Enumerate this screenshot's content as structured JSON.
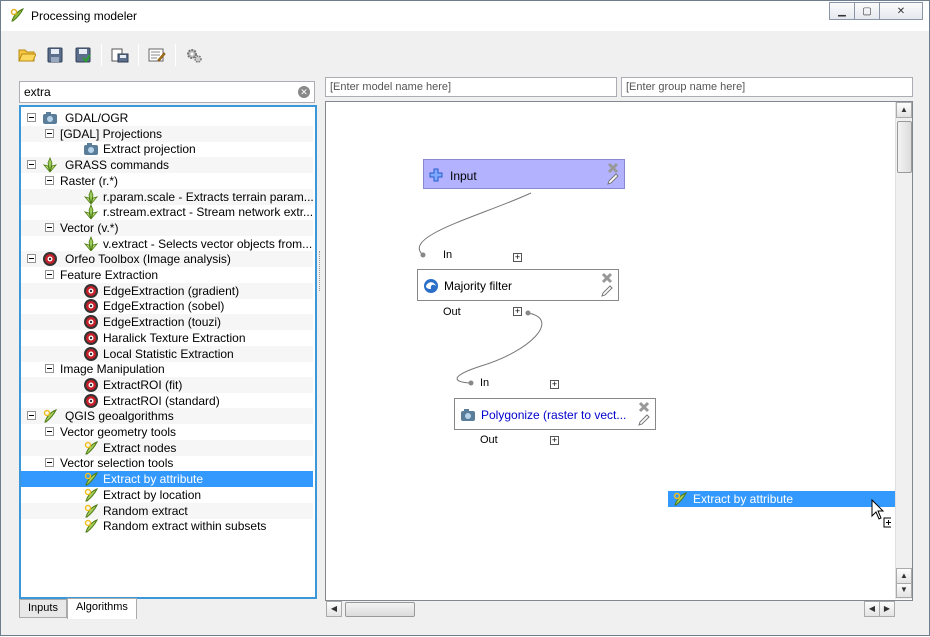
{
  "window": {
    "title": "Processing modeler",
    "minimize": "▁",
    "maximize": "▢",
    "close": "✕"
  },
  "toolbar": {
    "buttons": [
      {
        "name": "open-model",
        "icon": "folder-open-icon"
      },
      {
        "name": "save-model",
        "icon": "save-icon"
      },
      {
        "name": "save-as-model",
        "icon": "save-as-icon"
      },
      {
        "name": "export-image",
        "icon": "export-image-icon"
      },
      {
        "name": "edit-help",
        "icon": "edit-help-icon"
      },
      {
        "name": "run-model",
        "icon": "run-gears-icon"
      }
    ]
  },
  "search": {
    "value": "extra",
    "clear_icon": "✕"
  },
  "tree": {
    "rows": [
      {
        "label": "GDAL/OGR",
        "level": 0,
        "expander": true,
        "icon": "gdal-icon"
      },
      {
        "label": "[GDAL] Projections",
        "level": 1,
        "expander": true,
        "icon": ""
      },
      {
        "label": "Extract projection",
        "level": 2,
        "expander": false,
        "icon": "gdal-icon"
      },
      {
        "label": "GRASS commands",
        "level": 0,
        "expander": true,
        "icon": "grass-icon"
      },
      {
        "label": "Raster (r.*)",
        "level": 1,
        "expander": true,
        "icon": ""
      },
      {
        "label": "r.param.scale - Extracts terrain param...",
        "level": 2,
        "expander": false,
        "icon": "grass-icon"
      },
      {
        "label": "r.stream.extract - Stream network extr...",
        "level": 2,
        "expander": false,
        "icon": "grass-icon"
      },
      {
        "label": "Vector (v.*)",
        "level": 1,
        "expander": true,
        "icon": ""
      },
      {
        "label": "v.extract - Selects vector objects from...",
        "level": 2,
        "expander": false,
        "icon": "grass-icon"
      },
      {
        "label": "Orfeo Toolbox (Image analysis)",
        "level": 0,
        "expander": true,
        "icon": "otb-icon"
      },
      {
        "label": "Feature Extraction",
        "level": 1,
        "expander": true,
        "icon": ""
      },
      {
        "label": "EdgeExtraction (gradient)",
        "level": 2,
        "expander": false,
        "icon": "otb-icon"
      },
      {
        "label": "EdgeExtraction (sobel)",
        "level": 2,
        "expander": false,
        "icon": "otb-icon"
      },
      {
        "label": "EdgeExtraction (touzi)",
        "level": 2,
        "expander": false,
        "icon": "otb-icon"
      },
      {
        "label": "Haralick Texture Extraction",
        "level": 2,
        "expander": false,
        "icon": "otb-icon"
      },
      {
        "label": "Local Statistic Extraction",
        "level": 2,
        "expander": false,
        "icon": "otb-icon"
      },
      {
        "label": "Image Manipulation",
        "level": 1,
        "expander": true,
        "icon": ""
      },
      {
        "label": "ExtractROI (fit)",
        "level": 2,
        "expander": false,
        "icon": "otb-icon"
      },
      {
        "label": "ExtractROI (standard)",
        "level": 2,
        "expander": false,
        "icon": "otb-icon"
      },
      {
        "label": "QGIS geoalgorithms",
        "level": 0,
        "expander": true,
        "icon": "qgis-icon"
      },
      {
        "label": "Vector geometry tools",
        "level": 1,
        "expander": true,
        "icon": ""
      },
      {
        "label": "Extract nodes",
        "level": 2,
        "expander": false,
        "icon": "qgis-icon"
      },
      {
        "label": "Vector selection tools",
        "level": 1,
        "expander": true,
        "icon": ""
      },
      {
        "label": "Extract by attribute",
        "level": 2,
        "expander": false,
        "icon": "qgis-icon",
        "selected": true
      },
      {
        "label": "Extract by location",
        "level": 2,
        "expander": false,
        "icon": "qgis-icon"
      },
      {
        "label": "Random extract",
        "level": 2,
        "expander": false,
        "icon": "qgis-icon"
      },
      {
        "label": "Random extract within subsets",
        "level": 2,
        "expander": false,
        "icon": "qgis-icon"
      }
    ]
  },
  "tabs": [
    {
      "label": "Inputs",
      "active": false
    },
    {
      "label": "Algorithms",
      "active": true
    }
  ],
  "model": {
    "name_placeholder": "[Enter model name here]",
    "group_placeholder": "[Enter group name here]"
  },
  "canvas": {
    "nodes": {
      "input": {
        "label": "Input",
        "color": "#b2b2ff"
      },
      "majority": {
        "label": "Majority filter",
        "in": "In",
        "out": "Out"
      },
      "polygonize": {
        "label": "Polygonize (raster to vect...",
        "in": "In",
        "out": "Out",
        "color": "#0000cc"
      }
    },
    "drag_item": "Extract by attribute"
  },
  "colors": {
    "selection": "#3399ff",
    "input_node": "#b2b2ff",
    "tree_border": "#3c97d8"
  }
}
